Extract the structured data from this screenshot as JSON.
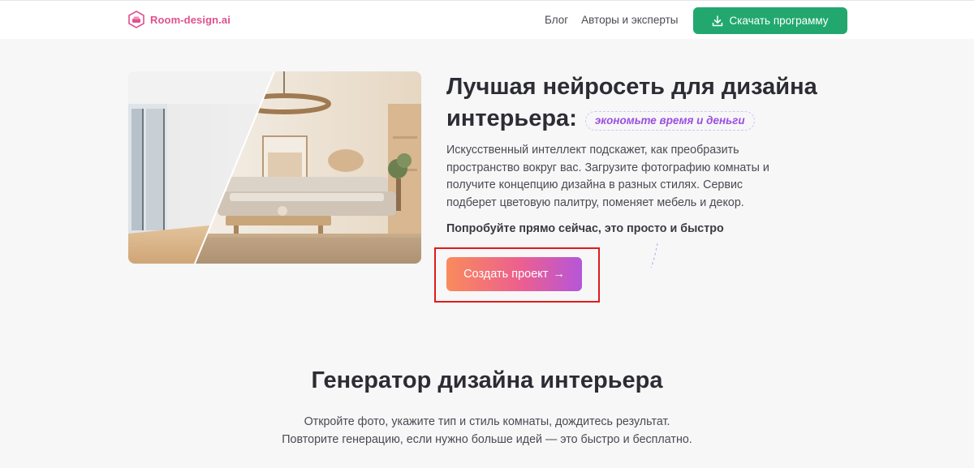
{
  "header": {
    "logo_text": "Room-design.ai",
    "nav": [
      {
        "label": "Блог"
      },
      {
        "label": "Авторы и эксперты"
      }
    ],
    "download_label": "Скачать программу"
  },
  "hero": {
    "title_line1": "Лучшая нейросеть для дизайна",
    "title_line2": "интерьера:",
    "tag": "экономьте время и деньги",
    "description": "Искусственный интеллект подскажет, как преобразить пространство вокруг вас. Загрузите фотографию комнаты и получите концепцию дизайна в разных стилях. Сервис подберет цветовую палитру, поменяет мебель и декор.",
    "cta_text": "Попробуйте прямо сейчас, это просто и быстро",
    "create_button": "Создать проект",
    "create_button_arrow": "→"
  },
  "generator": {
    "title": "Генератор дизайна интерьера",
    "desc_line1": "Откройте фото, укажите тип и стиль комнаты, дождитесь результат.",
    "desc_line2": "Повторите генерацию, если нужно больше идей — это быстро и бесплатно."
  },
  "colors": {
    "brand": "#e0508f",
    "download_green": "#22a86f",
    "tag_purple": "#9b4fe0",
    "highlight_red": "#e11b1b"
  },
  "icons": [
    "logo-icon",
    "download-icon",
    "arrow-right-icon"
  ]
}
